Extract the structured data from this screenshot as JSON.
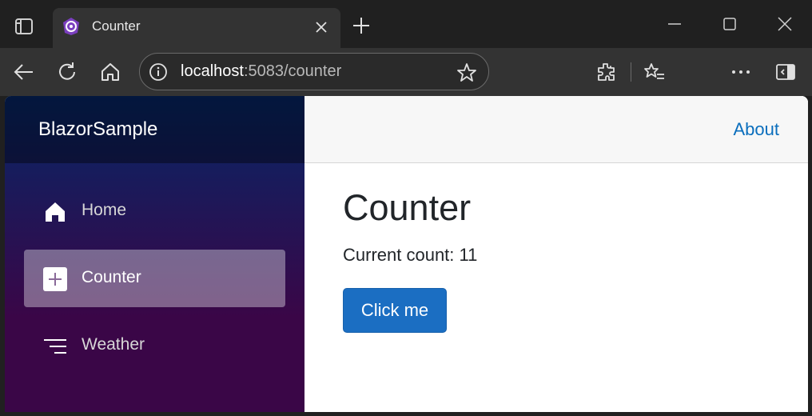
{
  "browser": {
    "tab_title": "Counter",
    "address": {
      "host": "localhost",
      "rest": ":5083/counter"
    },
    "icons": {
      "tab_actions": "tab-actions-icon",
      "favicon": "blazor-favicon-icon",
      "close": "close-icon",
      "new_tab": "plus-icon",
      "minimize": "minimize-icon",
      "maximize": "maximize-icon",
      "window_close": "close-icon",
      "back": "back-arrow-icon",
      "refresh": "refresh-icon",
      "home": "home-icon",
      "site_info": "info-icon",
      "favorite": "star-icon",
      "extensions": "puzzle-icon",
      "favorites": "favorites-list-icon",
      "more": "more-icon",
      "sidebar_toggle": "sidebar-icon"
    }
  },
  "app": {
    "brand": "BlazorSample",
    "nav": [
      {
        "label": "Home",
        "icon": "home-icon",
        "active": false
      },
      {
        "label": "Counter",
        "icon": "plus-square-icon",
        "active": true
      },
      {
        "label": "Weather",
        "icon": "list-lines-icon",
        "active": false
      }
    ],
    "top_row": {
      "about_label": "About"
    },
    "page": {
      "title": "Counter",
      "count_text": "Current count: 11",
      "button_label": "Click me"
    },
    "colors": {
      "accent_button": "#1b6ec2",
      "link": "#0a6ebd",
      "sidebar_top": "#052767",
      "sidebar_bottom": "#3a0647"
    }
  }
}
